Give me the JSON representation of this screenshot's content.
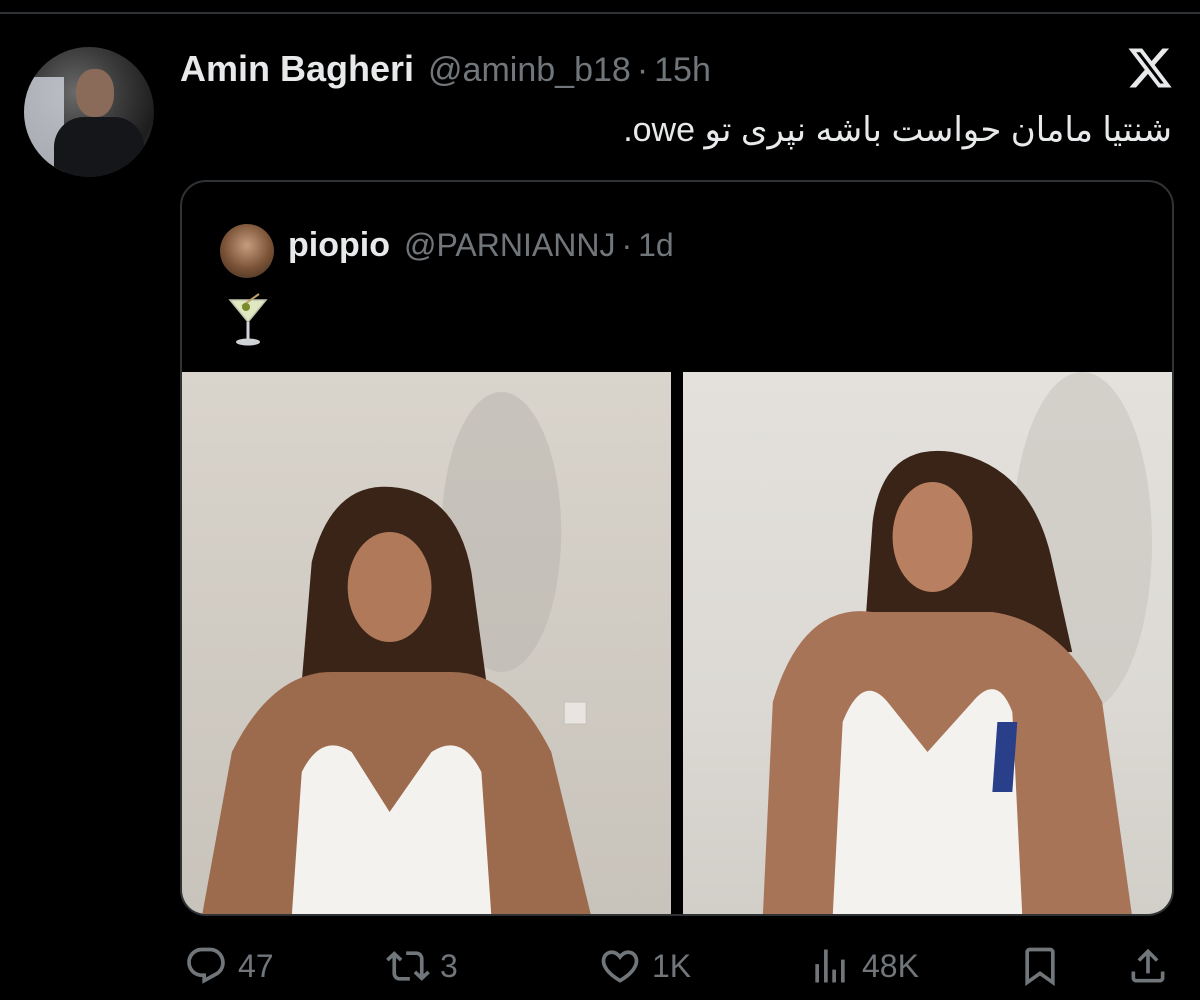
{
  "tweet": {
    "author_name": "Amin Bagheri",
    "handle": "@aminb_b18",
    "separator": "·",
    "time": "15h",
    "text": "شنتیا مامان حواست باشه نپری تو owe."
  },
  "quoted_tweet": {
    "author_name": "piopio",
    "handle": "@PARNIANNJ",
    "separator": "·",
    "time": "1d",
    "emoji": "cocktail-glass-icon"
  },
  "actions": {
    "replies": "47",
    "retweets": "3",
    "likes": "1K",
    "views": "48K"
  },
  "colors": {
    "background": "#000000",
    "text_primary": "#e7e9ea",
    "text_secondary": "#71767b",
    "border": "#2f3336"
  }
}
